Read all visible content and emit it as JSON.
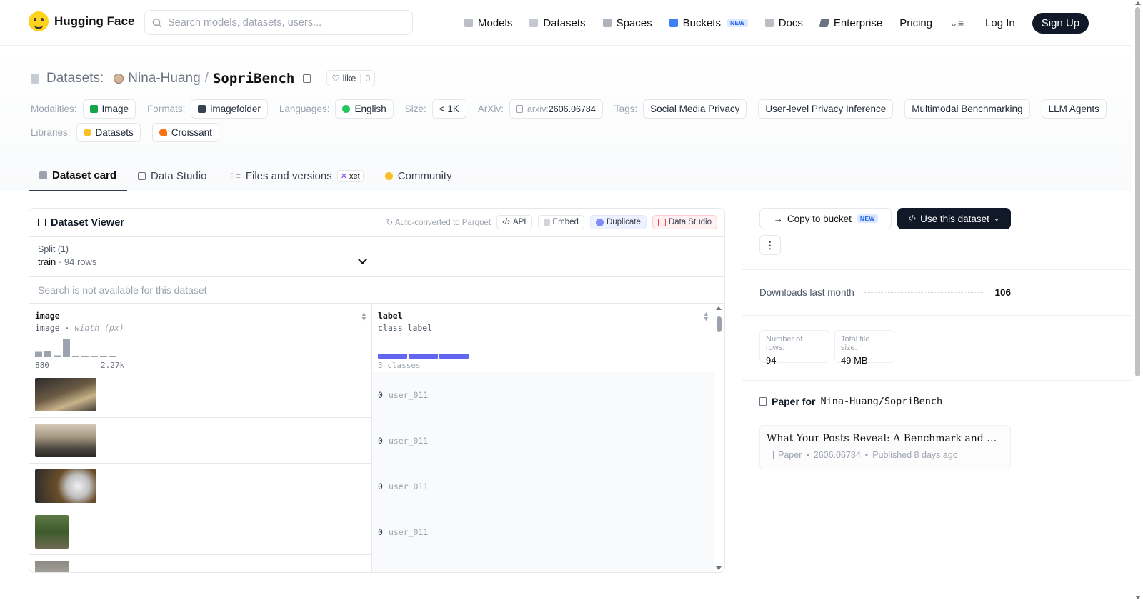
{
  "nav": {
    "brand": "Hugging Face",
    "search_placeholder": "Search models, datasets, users...",
    "links": [
      {
        "label": "Models",
        "icon": "models-icon"
      },
      {
        "label": "Datasets",
        "icon": "datasets-icon"
      },
      {
        "label": "Spaces",
        "icon": "spaces-icon"
      },
      {
        "label": "Buckets",
        "icon": "buckets-icon",
        "badge": "NEW"
      },
      {
        "label": "Docs",
        "icon": "docs-icon"
      },
      {
        "label": "Enterprise",
        "icon": "enterprise-icon"
      },
      {
        "label": "Pricing"
      }
    ],
    "login": "Log In",
    "signup": "Sign Up"
  },
  "header": {
    "prefix": "Datasets:",
    "owner": "Nina-Huang",
    "slash": "/",
    "name": "SopriBench",
    "like_label": "like",
    "like_count": "0"
  },
  "meta": {
    "modalities_label": "Modalities:",
    "modality": "Image",
    "formats_label": "Formats:",
    "format": "imagefolder",
    "languages_label": "Languages:",
    "language": "English",
    "size_label": "Size:",
    "size": "< 1K",
    "arxiv_label": "ArXiv:",
    "arxiv_prefix": "arxiv:",
    "arxiv_id": "2606.06784",
    "tags_label": "Tags:",
    "tags": [
      "Social Media Privacy",
      "User-level Privacy Inference",
      "Multimodal Benchmarking",
      "LLM Agents"
    ],
    "libraries_label": "Libraries:",
    "libraries": [
      "Datasets",
      "Croissant"
    ]
  },
  "tabs": [
    {
      "label": "Dataset card",
      "active": true
    },
    {
      "label": "Data Studio"
    },
    {
      "label": "Files and versions",
      "badge": "xet"
    },
    {
      "label": "Community"
    }
  ],
  "viewer": {
    "title": "Dataset Viewer",
    "auto_converted": "Auto-converted",
    "to_parquet": "to Parquet",
    "actions": [
      "API",
      "Embed",
      "Duplicate",
      "Data Studio"
    ],
    "split_label": "Split (1)",
    "split_value": "train",
    "split_rows": "94 rows",
    "search_na": "Search is not available for this dataset",
    "columns": [
      {
        "name": "image",
        "type": "image",
        "subtype": "width (px)",
        "hist_min": "880",
        "hist_max": "2.27k",
        "hist": [
          0.3,
          0.35,
          0.1,
          1.0,
          0.05,
          0.05,
          0.05,
          0.0,
          0.05
        ]
      },
      {
        "name": "label",
        "type": "class label",
        "classes": "3 classes"
      }
    ],
    "rows": [
      {
        "label_num": "0",
        "label": "user_011",
        "thumb": "cafe-table-photo"
      },
      {
        "label_num": "0",
        "label": "user_011",
        "thumb": "food-court-photo"
      },
      {
        "label_num": "0",
        "label": "user_011",
        "thumb": "drink-cup-photo"
      },
      {
        "label_num": "0",
        "label": "user_011",
        "thumb": "forest-path-photo"
      }
    ]
  },
  "sidebar": {
    "copy_bucket": "Copy to bucket",
    "new_badge": "NEW",
    "use_dataset": "Use this dataset",
    "downloads_label": "Downloads last month",
    "downloads_value": "106",
    "rows_label": "Number of rows:",
    "rows_value": "94",
    "filesize_label": "Total file size:",
    "filesize_value": "49 MB",
    "paper_for": "Paper for",
    "paper_repo": "Nina-Huang/SopriBench",
    "paper_title": "What Your Posts Reveal: A Benchmark and Agentic Framework",
    "paper_kind": "Paper",
    "paper_id": "2606.06784",
    "paper_published": "Published 8 days ago"
  }
}
